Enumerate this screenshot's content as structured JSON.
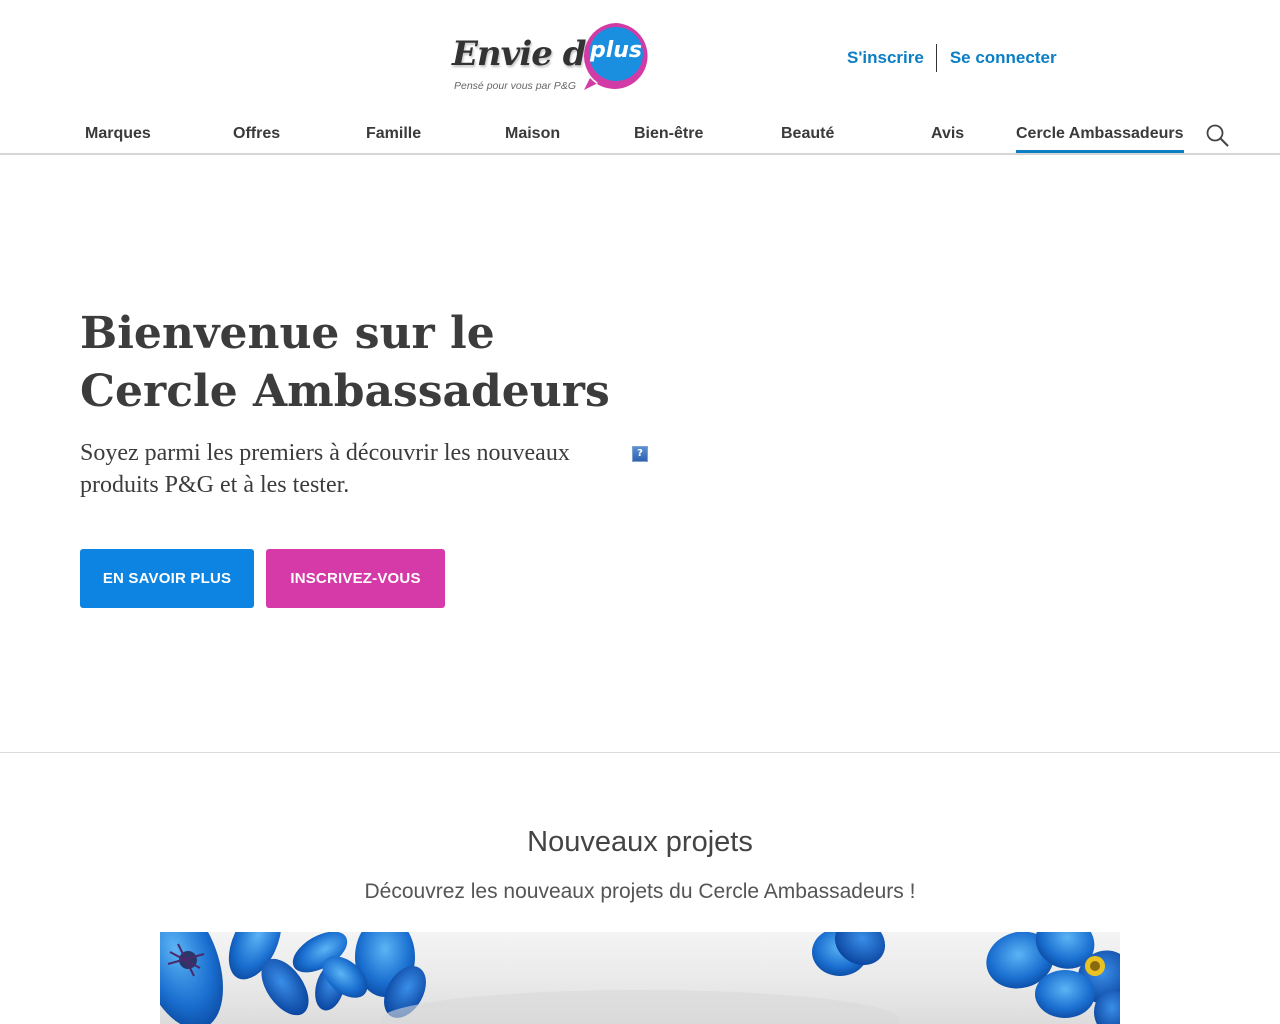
{
  "header": {
    "logo": {
      "word": "Envie de",
      "bubble": "plus",
      "tagline": "Pensé pour vous par P&G"
    },
    "auth": {
      "signup_label": "S'inscrire",
      "login_label": "Se connecter"
    },
    "nav": [
      {
        "label": "Marques"
      },
      {
        "label": "Offres"
      },
      {
        "label": "Famille"
      },
      {
        "label": "Maison"
      },
      {
        "label": "Bien-être"
      },
      {
        "label": "Beauté"
      },
      {
        "label": "Avis"
      },
      {
        "label": "Cercle Ambassadeurs",
        "active": true
      }
    ],
    "search_icon": "search-icon"
  },
  "hero": {
    "title": "Bienvenue sur le Cercle Ambassadeurs",
    "subtitle": "Soyez parmi les premiers à découvrir les nouveaux produits P&G et à les tester.",
    "broken_image_glyph": "?",
    "learn_more_label": "EN SAVOIR PLUS",
    "signup_label": "INSCRIVEZ-VOUS"
  },
  "projects": {
    "title": "Nouveaux projets",
    "subtitle": "Découvrez les nouveaux projets du Cercle Ambassadeurs !"
  },
  "colors": {
    "brand_blue": "#0b7ec4",
    "button_blue": "#0e84e2",
    "button_pink": "#d63aa8",
    "logo_magenta": "#d23ba6",
    "logo_blue": "#1a8fe0"
  }
}
